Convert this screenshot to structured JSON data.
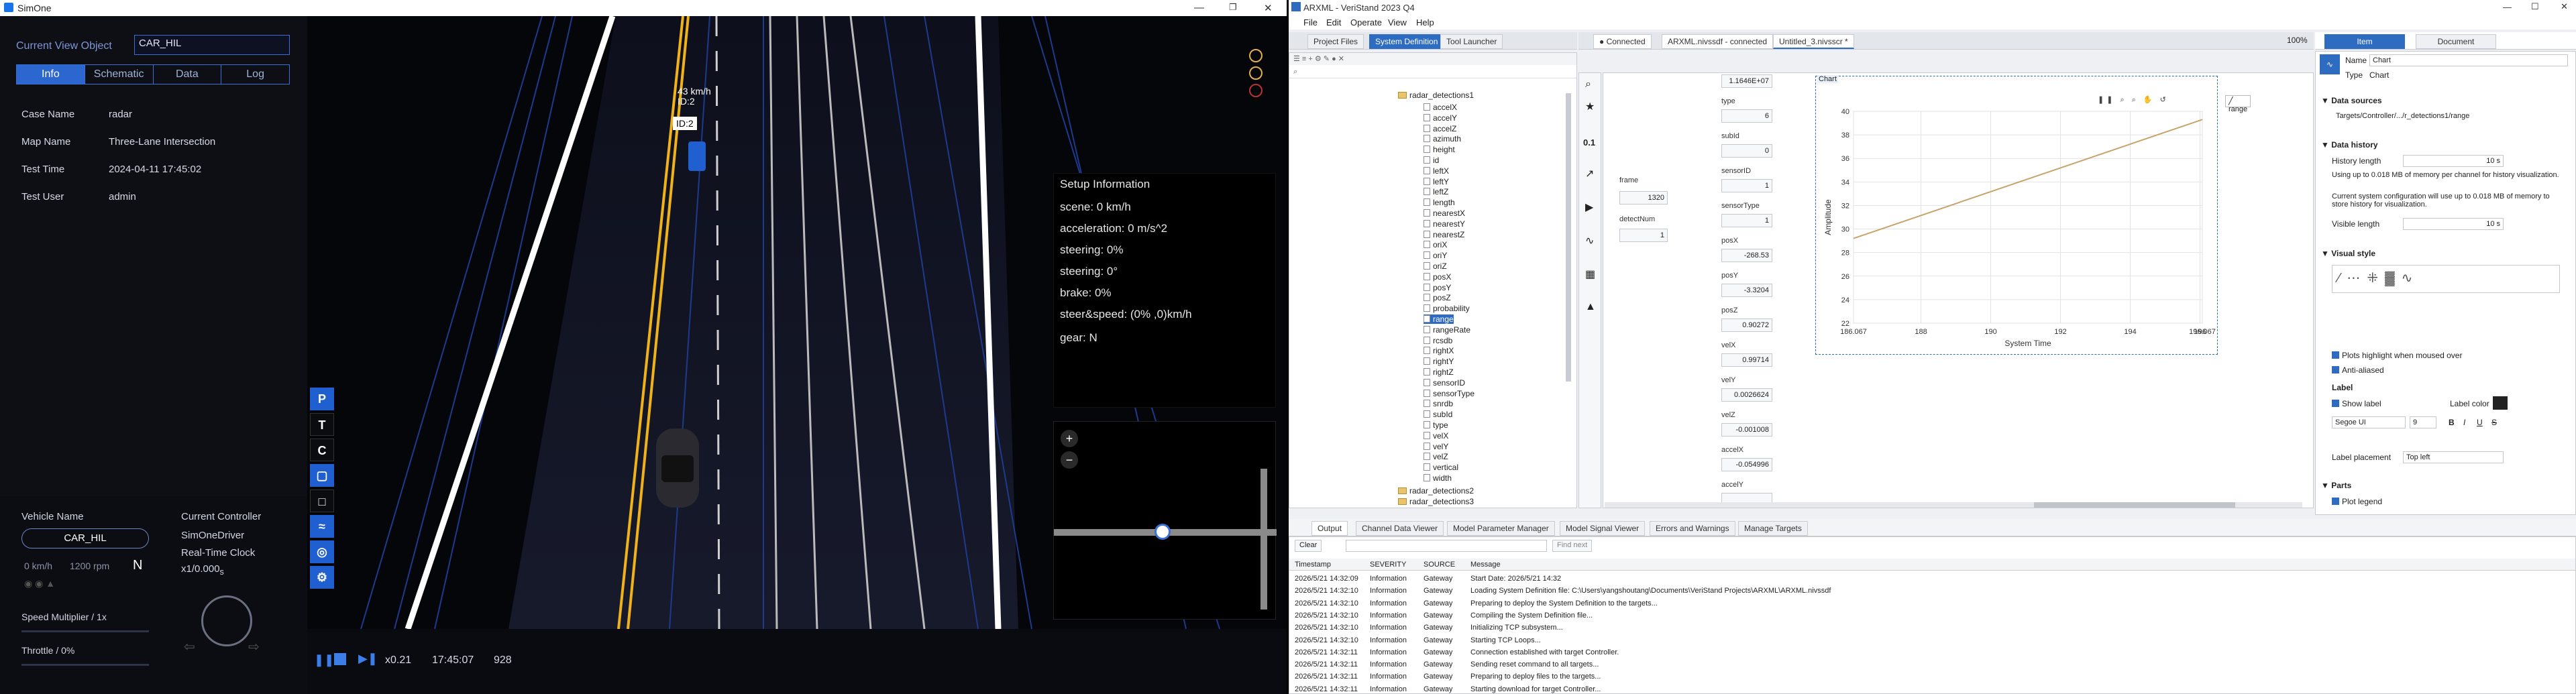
{
  "simone": {
    "title": "SimOne",
    "current_view_label": "Current View Object",
    "current_view_value": "CAR_HIL",
    "tabs": [
      "Info",
      "Schematic",
      "Data",
      "Log"
    ],
    "info": [
      {
        "label": "Case Name",
        "value": "radar"
      },
      {
        "label": "Map Name",
        "value": "Three-Lane Intersection"
      },
      {
        "label": "Test Time",
        "value": "2024-04-11 17:45:02"
      },
      {
        "label": "Test User",
        "value": "admin"
      }
    ],
    "collapse_glyph": "×",
    "target_label_speed": "43 km/h",
    "target_label_id": "ID:2",
    "target_tag": "ID:2",
    "setup": {
      "title": "Setup Information",
      "lines": [
        "scene: 0 km/h",
        "acceleration: 0 m/s^2",
        "steering: 0%",
        "steering: 0°",
        "brake: 0%",
        "steer&speed: (0% ,0)km/h",
        "gear: N"
      ]
    },
    "minimap_zoom_in": "+",
    "minimap_zoom_out": "−",
    "tools": [
      "P",
      "T",
      "C"
    ],
    "vehicle": {
      "name_label": "Vehicle Name",
      "name": "CAR_HIL",
      "speed": "0 km/h",
      "rpm": "1200 rpm",
      "gear": "N",
      "controller_label": "Current Controller",
      "controller": "SimOneDriver",
      "clock": "Real-Time Clock",
      "clock_rate": "x1/0.000",
      "clock_sub": "s",
      "speed_multiplier": "Speed Multiplier / 1x",
      "throttle": "Throttle / 0%"
    },
    "playback": {
      "rate": "x0.21",
      "time": "17:45:07",
      "frame": "928"
    }
  },
  "veristand": {
    "title": "ARXML - VeriStand 2023 Q4",
    "menu": [
      "File",
      "Edit",
      "Operate",
      "View",
      "Help"
    ],
    "left_tabs": [
      "Project Files",
      "System Definition",
      "Tool Launcher"
    ],
    "doc_tabs": {
      "connected": "Connected",
      "file1": "ARXML.nivssdf - connected",
      "file2": "Untitled_3.nivsscr *"
    },
    "tree_root": "radar_detections1",
    "tree_items": [
      "accelX",
      "accelY",
      "accelZ",
      "azimuth",
      "height",
      "id",
      "leftX",
      "leftY",
      "leftZ",
      "length",
      "nearestX",
      "nearestY",
      "nearestZ",
      "oriX",
      "oriY",
      "oriZ",
      "posX",
      "posY",
      "posZ",
      "probability",
      "range",
      "rangeRate",
      "rcsdb",
      "rightX",
      "rightY",
      "rightZ",
      "sensorID",
      "sensorType",
      "snrdb",
      "subId",
      "type",
      "velX",
      "velY",
      "velZ",
      "vertical",
      "width"
    ],
    "tree_selected": "range",
    "tree_after": [
      "radar_detections2",
      "radar_detections3"
    ],
    "frame_label": "frame",
    "frame_value": "1320",
    "detect_label": "detectNum",
    "detect_value": "1",
    "signals": [
      {
        "label": "",
        "value": "1.1646E+07"
      },
      {
        "label": "type",
        "value": "6"
      },
      {
        "label": "subId",
        "value": "0"
      },
      {
        "label": "sensorID",
        "value": "1"
      },
      {
        "label": "sensorType",
        "value": "1"
      },
      {
        "label": "posX",
        "value": "-268.53"
      },
      {
        "label": "posY",
        "value": "-3.3204"
      },
      {
        "label": "posZ",
        "value": "0.90272"
      },
      {
        "label": "velX",
        "value": "0.99714"
      },
      {
        "label": "velY",
        "value": "0.0026624"
      },
      {
        "label": "velZ",
        "value": "-0.001008"
      },
      {
        "label": "accelX",
        "value": "-0.054996"
      },
      {
        "label": "accelY",
        "value": ""
      }
    ],
    "zoom": "100%",
    "chart_title": "Chart",
    "chart_legend": "range",
    "log_tabs": [
      "Output",
      "Channel Data Viewer",
      "Model Parameter Manager",
      "Model Signal Viewer",
      "Errors and Warnings",
      "Manage Targets"
    ],
    "clear_label": "Clear",
    "find_label": "Find next",
    "log_headers": [
      "Timestamp",
      "SEVERITY",
      "SOURCE",
      "Message"
    ],
    "log_rows": [
      [
        "2026/5/21 14:32:09",
        "Information",
        "Gateway",
        "Start Date: 2026/5/21 14:32"
      ],
      [
        "2026/5/21 14:32:10",
        "Information",
        "Gateway",
        "Loading System Definition file: C:\\Users\\yangshoutang\\Documents\\VeriStand Projects\\ARXML\\ARXML.nivssdf"
      ],
      [
        "2026/5/21 14:32:10",
        "Information",
        "Gateway",
        "Preparing to deploy the System Definition to the targets..."
      ],
      [
        "2026/5/21 14:32:10",
        "Information",
        "Gateway",
        "Compiling the System Definition file..."
      ],
      [
        "2026/5/21 14:32:10",
        "Information",
        "Gateway",
        "Initializing TCP subsystem..."
      ],
      [
        "2026/5/21 14:32:10",
        "Information",
        "Gateway",
        "Starting TCP Loops..."
      ],
      [
        "2026/5/21 14:32:11",
        "Information",
        "Gateway",
        "Connection established with target Controller."
      ],
      [
        "2026/5/21 14:32:11",
        "Information",
        "Gateway",
        "Sending reset command to all targets..."
      ],
      [
        "2026/5/21 14:32:11",
        "Information",
        "Gateway",
        "Preparing to deploy files to the targets..."
      ],
      [
        "2026/5/21 14:32:11",
        "Information",
        "Gateway",
        "Starting download for target Controller..."
      ]
    ],
    "props": {
      "tabs": [
        "Item",
        "Document"
      ],
      "name_label": "Name",
      "name_value": "Chart",
      "type_label": "Type",
      "type_value": "Chart",
      "data_sources": "Data sources",
      "data_source_path": "Targets/Controller/.../r_detections1/range",
      "data_history": "Data history",
      "history_length": "History length",
      "history_length_value": "10 s",
      "history_note1": "Using up to 0.018 MB of memory per channel for history visualization.",
      "history_note2": "Current system configuration will use up to 0.018 MB of memory to store history for visualization.",
      "visible_length": "Visible length",
      "visible_length_value": "10 s",
      "visual_style": "Visual style",
      "plots_highlight": "Plots highlight when moused over",
      "anti_aliased": "Anti-aliased",
      "label_head": "Label",
      "show_label": "Show label",
      "label_color": "Label color",
      "font": "Segoe UI",
      "font_size": "9",
      "format_buttons": [
        "B",
        "I",
        "U",
        "S"
      ],
      "label_placement": "Label placement",
      "label_placement_value": "Top left",
      "parts": "Parts",
      "plot_legend": "Plot legend"
    }
  },
  "chart_data": {
    "type": "line",
    "title": "Chart",
    "xlabel": "System Time",
    "ylabel": "Amplitude",
    "xlim": [
      186.067,
      196.067
    ],
    "ylim": [
      22,
      40
    ],
    "xticks": [
      "186.067",
      "188",
      "190",
      "192",
      "194",
      "196",
      "196.067"
    ],
    "yticks": [
      "22",
      "24",
      "26",
      "28",
      "30",
      "32",
      "34",
      "36",
      "38",
      "40"
    ],
    "series": [
      {
        "name": "range",
        "x": [
          186.067,
          196.067
        ],
        "y": [
          29.2,
          39.3
        ],
        "color": "#c9a46a"
      }
    ]
  }
}
